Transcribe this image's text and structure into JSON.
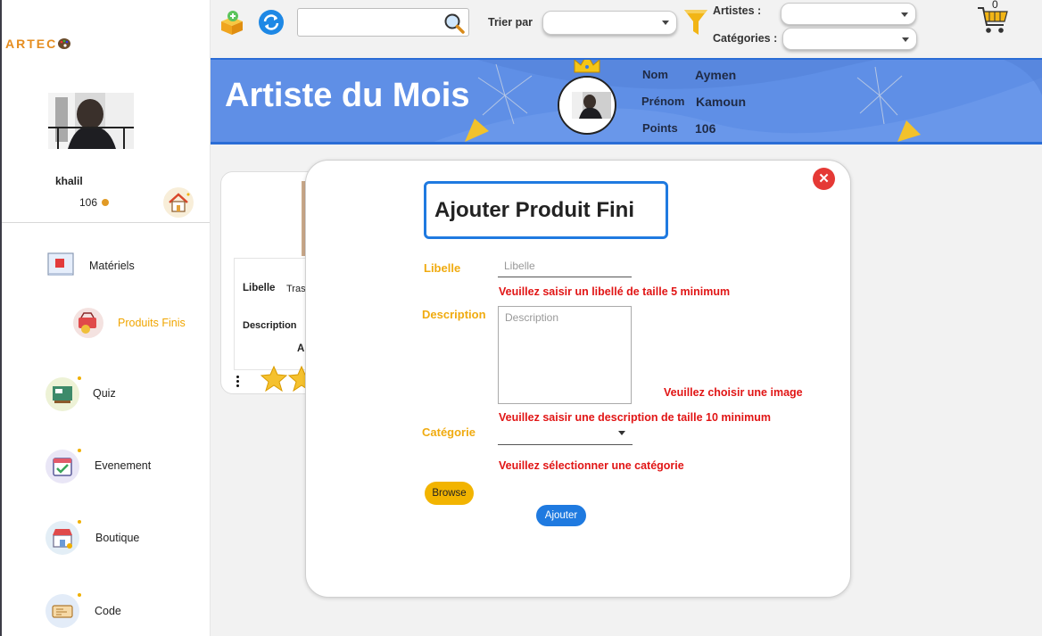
{
  "sidebar": {
    "logo": "ARTEC",
    "username": "khalil",
    "points": "106",
    "items": [
      {
        "label": "Matériels"
      },
      {
        "label": "Produits Finis"
      },
      {
        "label": "Quiz"
      },
      {
        "label": "Evenement"
      },
      {
        "label": "Boutique"
      },
      {
        "label": "Code"
      }
    ]
  },
  "topbar": {
    "search_placeholder": "",
    "sort_label": "Trier par",
    "artists_label": "Artistes :",
    "categories_label": "Catégories :",
    "cart_count": "0"
  },
  "banner": {
    "title": "Artiste du Mois",
    "nom_label": "Nom",
    "nom_value": "Aymen",
    "prenom_label": "Prénom",
    "prenom_value": "Kamoun",
    "points_label": "Points",
    "points_value": "106"
  },
  "card": {
    "libelle_label": "Libelle",
    "libelle_value": "Tras",
    "description_label": "Description",
    "extra_text": "A"
  },
  "modal": {
    "title": "Ajouter Produit Fini",
    "libelle_label": "Libelle",
    "libelle_placeholder": "Libelle",
    "libelle_error": "Veuillez saisir un libellé de taille  5 minimum",
    "description_label": "Description",
    "description_placeholder": "Description",
    "image_error": "Veuillez choisir une image",
    "description_error": "Veuillez saisir une description de taille  10 minimum",
    "categorie_label": "Catégorie",
    "categorie_error": "Veuillez sélectionner une catégorie",
    "browse_label": "Browse",
    "submit_label": "Ajouter"
  },
  "colors": {
    "accent_blue": "#1f7ae0",
    "banner_blue": "#5f8fe6",
    "label_orange": "#f0ab10",
    "error_red": "#e11515",
    "button_yellow": "#f2b400",
    "close_red": "#e53935"
  },
  "icons": [
    "add-product-icon",
    "refresh-icon",
    "search-icon",
    "filter-funnel-icon",
    "cart-icon",
    "home-icon",
    "crown-icon",
    "close-icon",
    "star-icon"
  ]
}
